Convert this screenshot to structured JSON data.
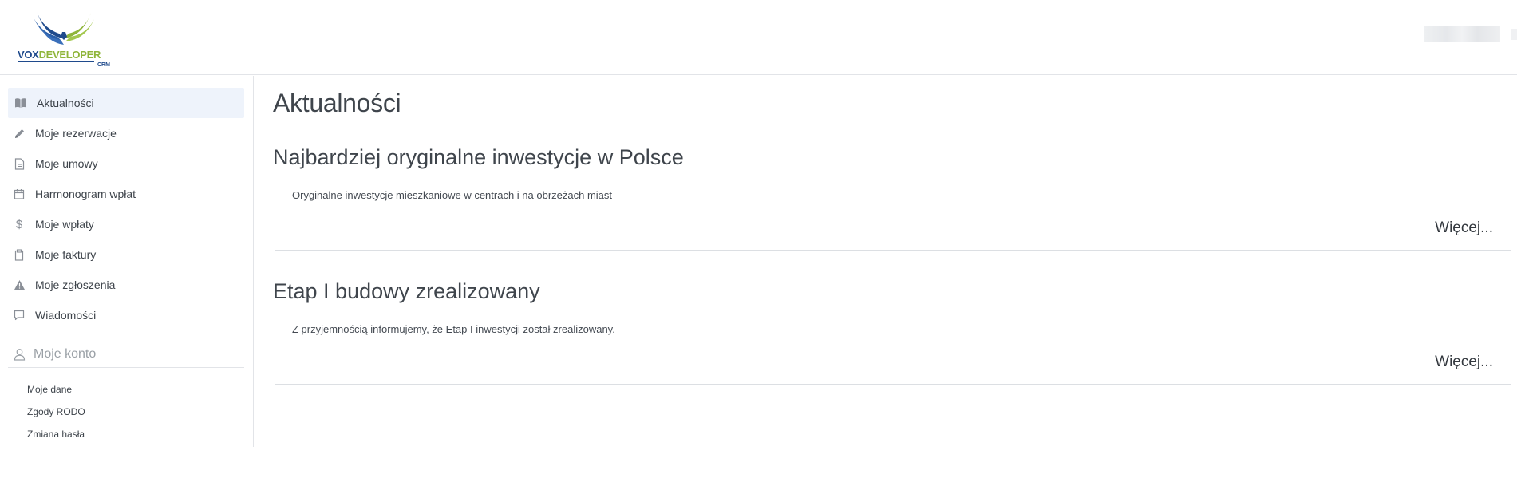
{
  "header": {
    "logo": {
      "vox": "VOX",
      "developer": "DEVELOPER",
      "crm": "CRM"
    },
    "colors": {
      "logo_blue": "#1f4a8c",
      "logo_green": "#8fb53a"
    }
  },
  "sidebar": {
    "items": [
      {
        "label": "Aktualności",
        "icon": "open-book-icon",
        "active": true
      },
      {
        "label": "Moje rezerwacje",
        "icon": "pencil-icon"
      },
      {
        "label": "Moje umowy",
        "icon": "document-icon"
      },
      {
        "label": "Harmonogram wpłat",
        "icon": "calendar-icon"
      },
      {
        "label": "Moje wpłaty",
        "icon": "dollar-icon"
      },
      {
        "label": "Moje faktury",
        "icon": "clipboard-icon"
      },
      {
        "label": "Moje zgłoszenia",
        "icon": "warning-icon"
      },
      {
        "label": "Wiadomości",
        "icon": "chat-icon"
      }
    ],
    "account": {
      "label": "Moje konto",
      "icon": "user-icon",
      "subitems": [
        "Moje dane",
        "Zgody RODO",
        "Zmiana hasła"
      ]
    }
  },
  "main": {
    "title": "Aktualności",
    "news": [
      {
        "title": "Najbardziej oryginalne inwestycje w Polsce",
        "description": "Oryginalne inwestycje mieszkaniowe w centrach i na obrzeżach miast",
        "more": "Więcej..."
      },
      {
        "title": "Etap I budowy zrealizowany",
        "description": "Z przyjemnością informujemy, że Etap I inwestycji został zrealizowany.",
        "more": "Więcej..."
      }
    ]
  }
}
